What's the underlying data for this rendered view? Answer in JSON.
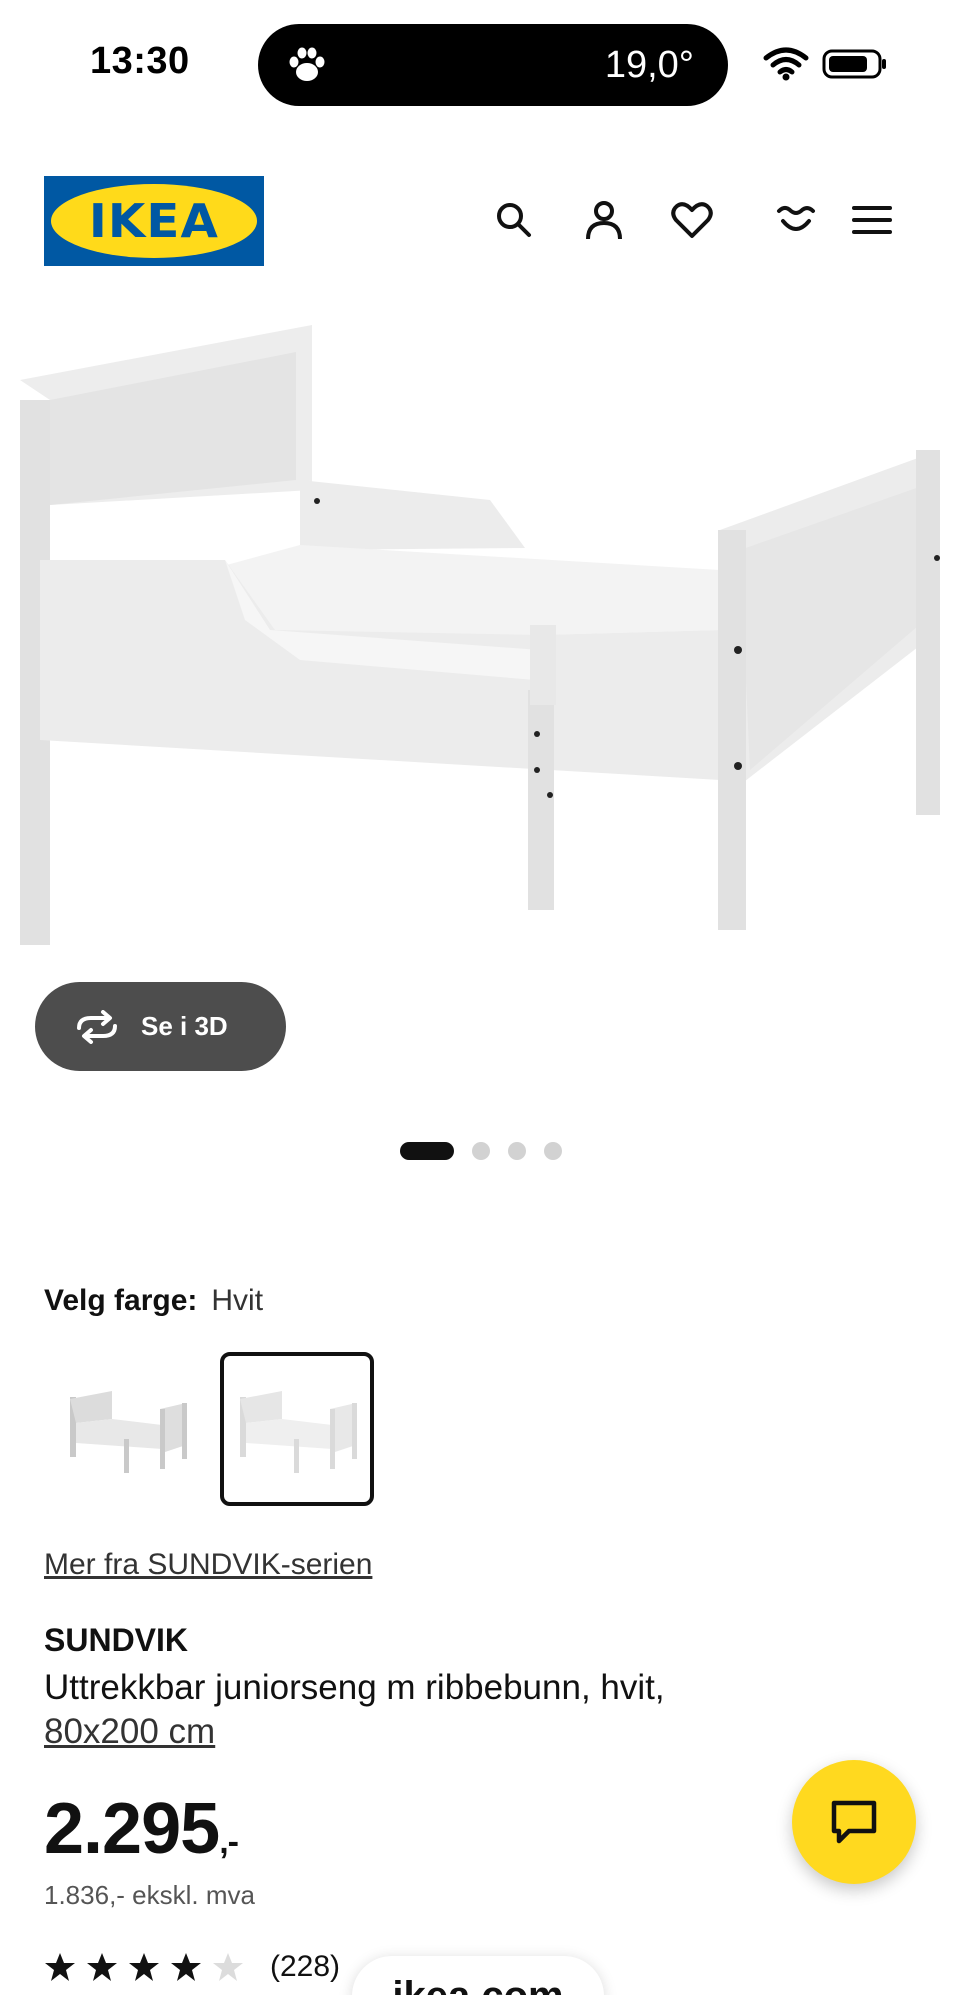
{
  "status_bar": {
    "time": "13:30",
    "temperature": "19,0°",
    "island_icon": "paw-icon",
    "wifi_icon": "wifi-icon",
    "battery_icon": "battery-icon"
  },
  "header": {
    "logo_text": "IKEA",
    "icons": [
      "search-icon",
      "user-icon",
      "heart-icon",
      "cart-icon",
      "menu-icon"
    ],
    "brand_colors": {
      "blue": "#0058a3",
      "yellow": "#ffda1a"
    }
  },
  "gallery": {
    "view_3d_label": "Se i 3D",
    "slide_count": 4,
    "active_slide": 1
  },
  "color_picker": {
    "label": "Velg farge:",
    "selected_value": "Hvit",
    "swatch_count": 2,
    "selected_swatch": 2
  },
  "series_link": "Mer fra SUNDVIK-serien",
  "product": {
    "name": "SUNDVIK",
    "description": "Uttrekkbar juniorseng m ribbebunn, hvit,",
    "size": "80x200 cm",
    "price": "2.295",
    "price_suffix": ",-",
    "price_ex_vat": "1.836,- ekskl. mva",
    "rating_stars": 4,
    "rating_max": 5,
    "review_count": "(228)"
  },
  "browser": {
    "url_text": "ikea.com"
  },
  "chat_button": {
    "icon": "chat-icon",
    "color": "#ffd91f"
  }
}
